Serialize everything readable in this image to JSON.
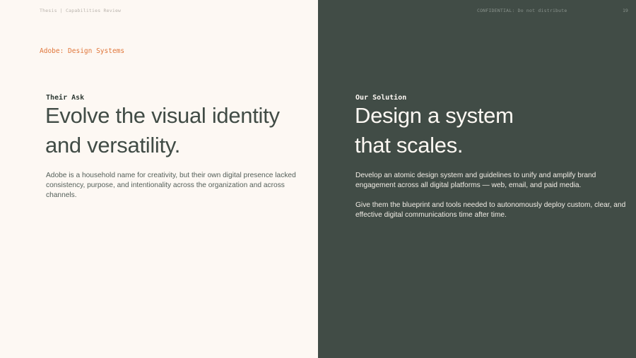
{
  "header": {
    "left_text": "Thesis | Capabilities Review",
    "confidential": "CONFIDENTIAL: Do not distribute",
    "page_number": "19"
  },
  "client_label": "Adobe: Design Systems",
  "left": {
    "label": "Their Ask",
    "headline_line1": "Evolve the visual identity",
    "headline_line2": "and versatility.",
    "body": "Adobe is a household name for creativity, but their own digital presence lacked consistency, purpose, and intentionality across the organization and across channels."
  },
  "right": {
    "label": "Our Solution",
    "headline_line1": "Design a system",
    "headline_line2": "that scales.",
    "paragraph1": "Develop an atomic design system and guidelines to unify and amplify brand engagement across all digital platforms — web, email, and paid media.",
    "paragraph2": "Give them the blueprint and tools needed to autonomously deploy custom, clear, and effective digital communications time after time."
  },
  "colors": {
    "left_background": "#fdf8f3",
    "right_background": "#414c46",
    "accent": "#e0763a"
  }
}
